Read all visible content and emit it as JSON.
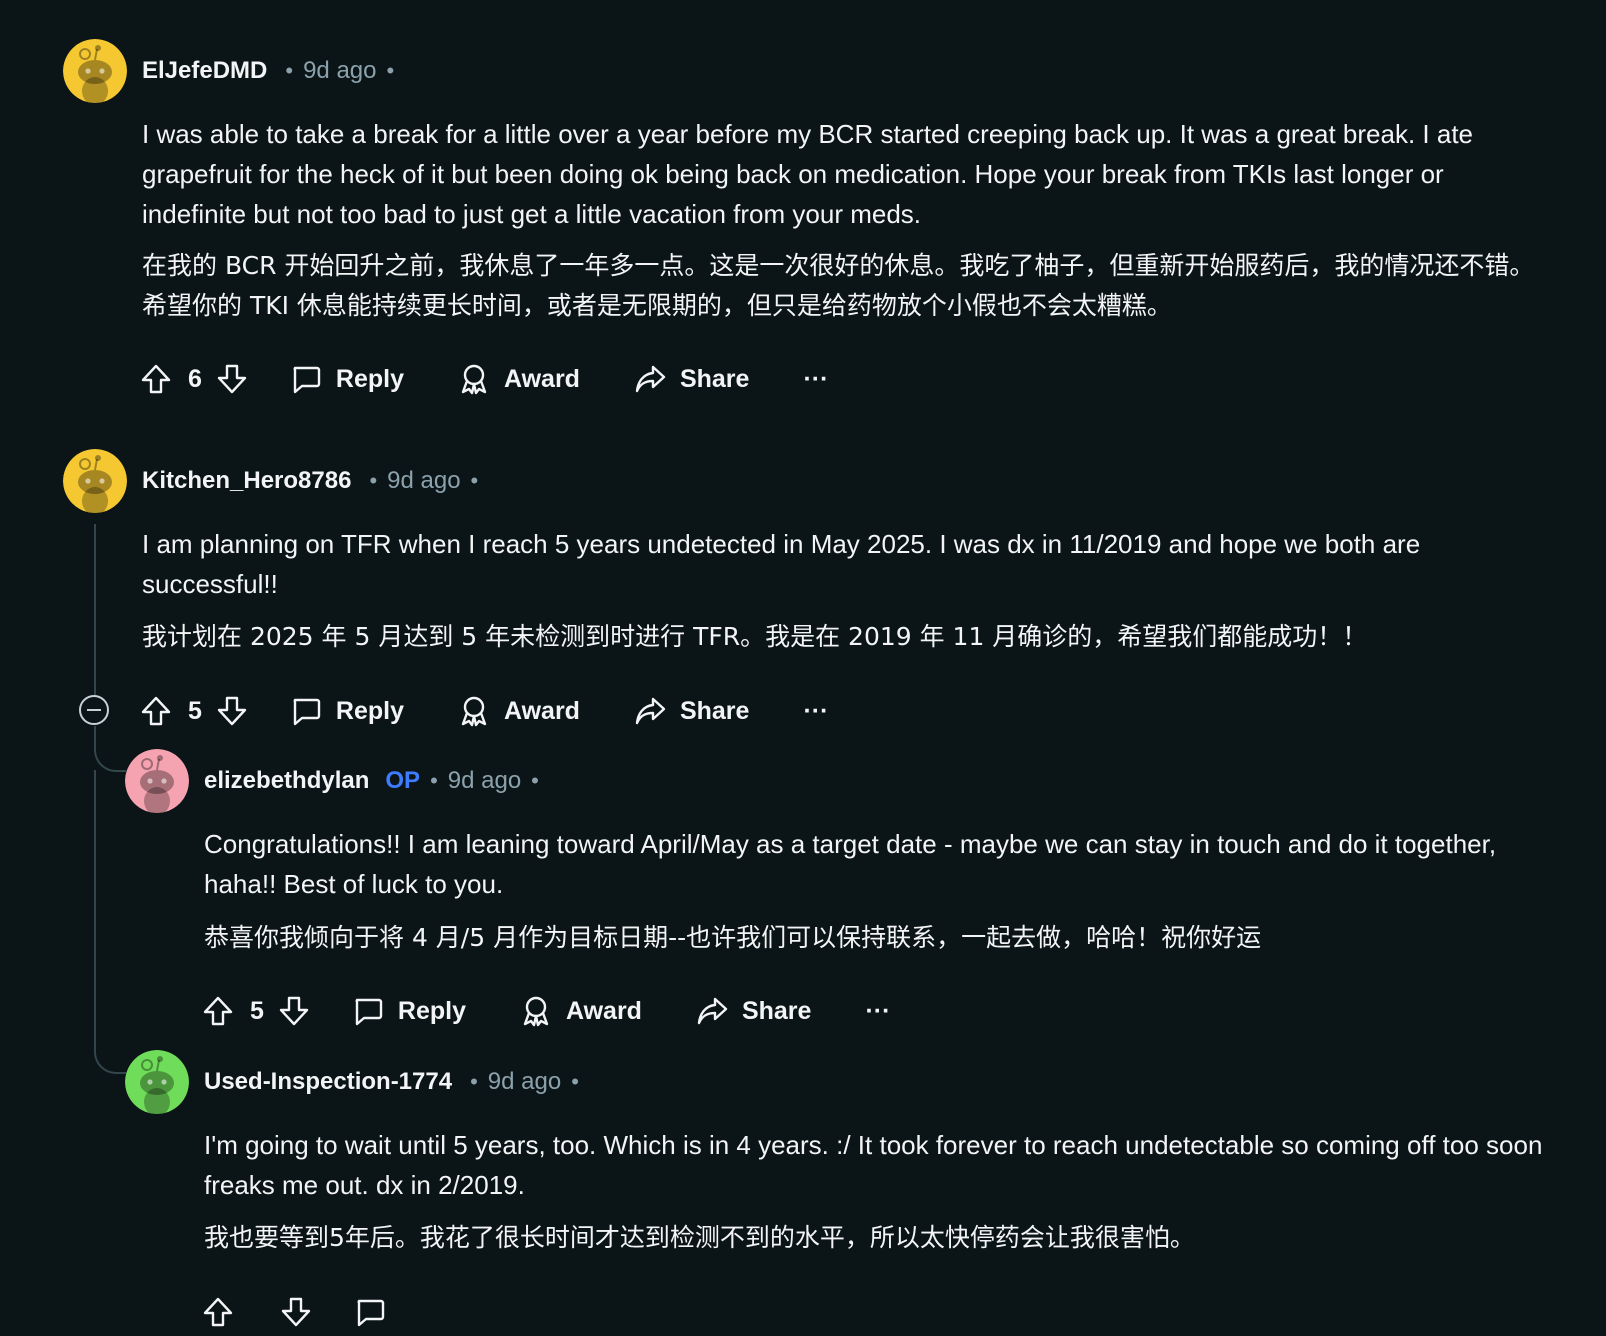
{
  "labels": {
    "reply": "Reply",
    "award": "Award",
    "share": "Share",
    "more": "···",
    "separator": "•"
  },
  "comments": [
    {
      "username": "ElJefeDMD",
      "time": "9d ago",
      "avatar_color": "#f5c832",
      "text_en": "I was able to take a break for a little over a year before my BCR started creeping back up. It was a great break. I ate grapefruit for the heck of it but been doing ok being back on medication. Hope your break from TKIs last longer or indefinite but not too bad to just get a little vacation from your meds.",
      "text_zh": "在我的 BCR 开始回升之前，我休息了一年多一点。这是一次很好的休息。我吃了柚子，但重新开始服药后，我的情况还不错。希望你的 TKI 休息能持续更长时间，或者是无限期的，但只是给药物放个小假也不会太糟糕。",
      "votes": "6"
    },
    {
      "username": "Kitchen_Hero8786",
      "time": "9d ago",
      "avatar_color": "#f5c832",
      "text_en": "I am planning on TFR when I reach 5 years undetected in May 2025. I was dx in 11/2019 and hope we both are successful!!",
      "text_zh": "我计划在 2025 年 5 月达到 5 年未检测到时进行 TFR。我是在 2019 年 11 月确诊的，希望我们都能成功！！",
      "votes": "5"
    },
    {
      "username": "elizebethdylan",
      "op_badge": "OP",
      "time": "9d ago",
      "avatar_color": "#f5a3b0",
      "text_en": "Congratulations!! I am leaning toward April/May as a target date - maybe we can stay in touch and do it together, haha!! Best of luck to you.",
      "text_zh": "恭喜你我倾向于将 4 月/5 月作为目标日期--也许我们可以保持联系，一起去做，哈哈！祝你好运",
      "votes": "5"
    },
    {
      "username": "Used-Inspection-1774",
      "time": "9d ago",
      "avatar_color": "#6fdc5a",
      "text_en": "I'm going to wait until 5 years, too. Which is in 4 years. :/ It took forever to reach undetectable so coming off too soon freaks me out. dx in 2/2019.",
      "text_zh": "我也要等到5年后。我花了很长时间才达到检测不到的水平，所以太快停药会让我很害怕。"
    }
  ],
  "colors": {
    "background": "#0b1416",
    "text": "#f2f4f5",
    "meta": "#8ba2ad",
    "op": "#3d7bff",
    "thread_line": "#33464c"
  }
}
